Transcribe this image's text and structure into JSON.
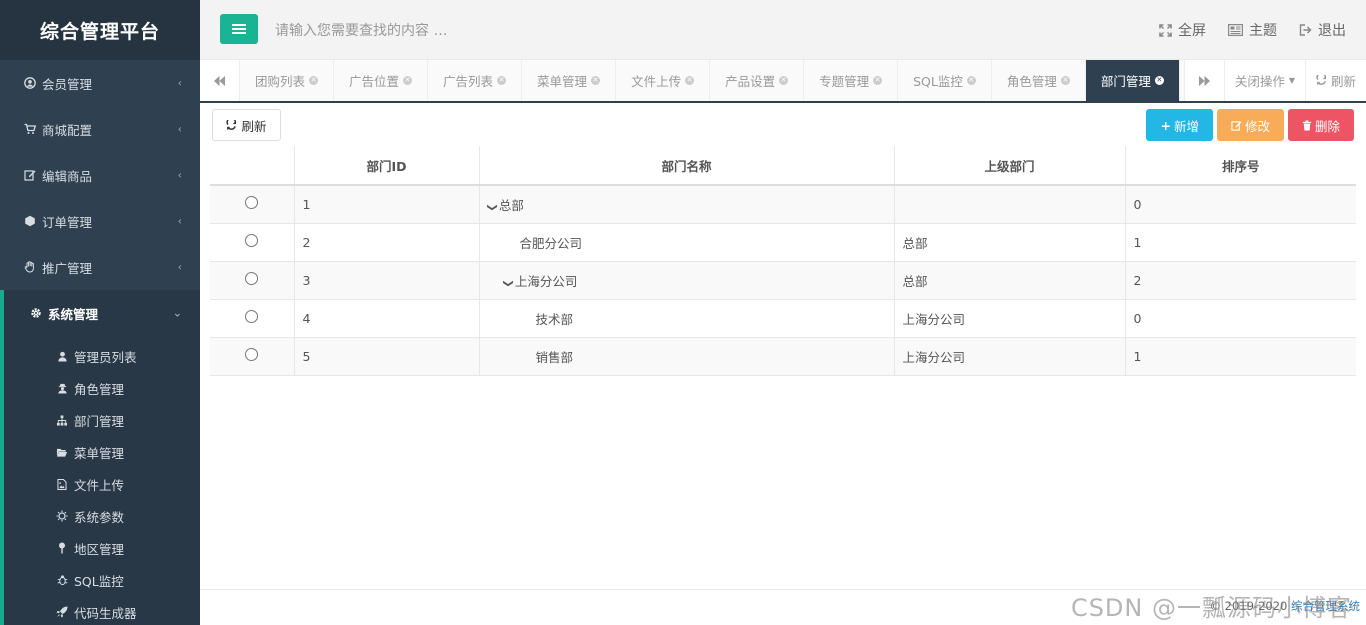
{
  "brand": "综合管理平台",
  "sidebar": {
    "items": [
      {
        "label": "会员管理",
        "icon": "user-circle-icon"
      },
      {
        "label": "商城配置",
        "icon": "cart-icon"
      },
      {
        "label": "编辑商品",
        "icon": "edit-icon"
      },
      {
        "label": "订单管理",
        "icon": "cube-icon"
      },
      {
        "label": "推广管理",
        "icon": "hand-icon"
      },
      {
        "label": "系统管理",
        "icon": "gear-icon"
      }
    ],
    "subitems": [
      {
        "label": "管理员列表",
        "icon": "user-icon"
      },
      {
        "label": "角色管理",
        "icon": "user-secret-icon"
      },
      {
        "label": "部门管理",
        "icon": "sitemap-icon"
      },
      {
        "label": "菜单管理",
        "icon": "folder-open-icon"
      },
      {
        "label": "文件上传",
        "icon": "file-image-icon"
      },
      {
        "label": "系统参数",
        "icon": "sun-icon"
      },
      {
        "label": "地区管理",
        "icon": "map-pin-icon"
      },
      {
        "label": "SQL监控",
        "icon": "bug-icon"
      },
      {
        "label": "代码生成器",
        "icon": "rocket-icon"
      }
    ]
  },
  "header": {
    "search_placeholder": "请输入您需要查找的内容 …",
    "fullscreen": "全屏",
    "theme": "主题",
    "logout": "退出"
  },
  "tabs": [
    {
      "label": "团购列表"
    },
    {
      "label": "广告位置"
    },
    {
      "label": "广告列表"
    },
    {
      "label": "菜单管理"
    },
    {
      "label": "文件上传"
    },
    {
      "label": "产品设置"
    },
    {
      "label": "专题管理"
    },
    {
      "label": "SQL监控"
    },
    {
      "label": "角色管理"
    },
    {
      "label": "部门管理"
    }
  ],
  "tab_ops": {
    "close_ops": "关闭操作",
    "refresh": "刷新"
  },
  "toolbar": {
    "refresh": "刷新",
    "add": "新增",
    "edit": "修改",
    "delete": "删除"
  },
  "table": {
    "headers": [
      "部门ID",
      "部门名称",
      "上级部门",
      "排序号"
    ],
    "rows": [
      {
        "id": "1",
        "name": "总部",
        "parent": "",
        "order": "0",
        "level": 0,
        "expanded": true
      },
      {
        "id": "2",
        "name": "合肥分公司",
        "parent": "总部",
        "order": "1",
        "level": 1,
        "expanded": false
      },
      {
        "id": "3",
        "name": "上海分公司",
        "parent": "总部",
        "order": "2",
        "level": 1,
        "expanded": true
      },
      {
        "id": "4",
        "name": "技术部",
        "parent": "上海分公司",
        "order": "0",
        "level": 2,
        "expanded": false
      },
      {
        "id": "5",
        "name": "销售部",
        "parent": "上海分公司",
        "order": "1",
        "level": 2,
        "expanded": false
      }
    ]
  },
  "footer": {
    "copyright": "© 2019-2020",
    "link": "综合管理系统"
  },
  "watermark": "CSDN @一瓢源码小博客",
  "colors": {
    "sidebar": "#2f4050",
    "accent": "#1ab394",
    "add": "#23b7e5",
    "edit": "#f8ac59",
    "delete": "#ed5565"
  }
}
